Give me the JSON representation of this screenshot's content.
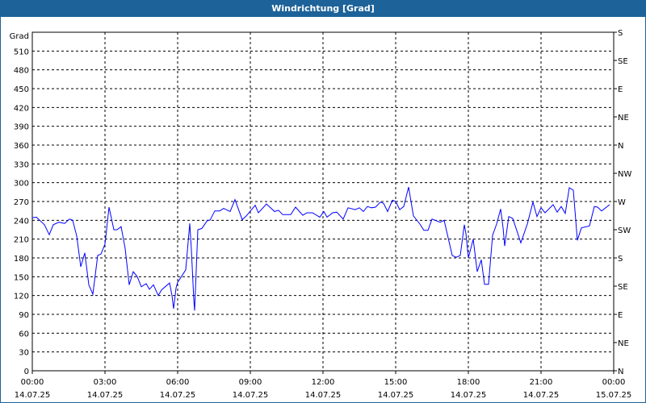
{
  "window": {
    "title": "Windrichtung [Grad]"
  },
  "colors": {
    "titlebar": "#1d6399",
    "series": "#0000ff",
    "grid": "#000000"
  },
  "chart_data": {
    "type": "line",
    "title": "Windrichtung [Grad]",
    "ylabel": "Grad",
    "ylim": [
      0,
      540
    ],
    "y_ticks": [
      0,
      30,
      60,
      90,
      120,
      150,
      180,
      210,
      240,
      270,
      300,
      330,
      360,
      390,
      420,
      450,
      480,
      510
    ],
    "y2_ticks": [
      {
        "value": 540,
        "label": "S"
      },
      {
        "value": 495,
        "label": "SE"
      },
      {
        "value": 450,
        "label": "E"
      },
      {
        "value": 405,
        "label": "NE"
      },
      {
        "value": 360,
        "label": "N"
      },
      {
        "value": 315,
        "label": "NW"
      },
      {
        "value": 270,
        "label": "W"
      },
      {
        "value": 225,
        "label": "SW"
      },
      {
        "value": 180,
        "label": "S"
      },
      {
        "value": 135,
        "label": "SE"
      },
      {
        "value": 90,
        "label": "E"
      },
      {
        "value": 45,
        "label": "NE"
      },
      {
        "value": 0,
        "label": "N"
      }
    ],
    "xlim": [
      "14.07.25 00:00",
      "15.07.25 00:00"
    ],
    "x_ticks": [
      {
        "time": "00:00",
        "date": "14.07.25"
      },
      {
        "time": "03:00",
        "date": "14.07.25"
      },
      {
        "time": "06:00",
        "date": "14.07.25"
      },
      {
        "time": "09:00",
        "date": "14.07.25"
      },
      {
        "time": "12:00",
        "date": "14.07.25"
      },
      {
        "time": "15:00",
        "date": "14.07.25"
      },
      {
        "time": "18:00",
        "date": "14.07.25"
      },
      {
        "time": "21:00",
        "date": "14.07.25"
      },
      {
        "time": "00:00",
        "date": "15.07.25"
      }
    ],
    "grid": true,
    "series": [
      {
        "x": [
          "00:00",
          "00:10",
          "00:30",
          "00:42",
          "00:52",
          "01:06",
          "01:20",
          "01:32",
          "01:40",
          "01:50",
          "02:00",
          "02:10",
          "02:20",
          "02:30",
          "02:42",
          "02:50",
          "03:00",
          "03:10",
          "03:22",
          "03:30",
          "03:40",
          "03:50",
          "04:00",
          "04:10",
          "04:20",
          "04:30",
          "04:42",
          "04:50",
          "05:00",
          "05:12",
          "05:20",
          "05:40",
          "05:46",
          "05:50",
          "05:56",
          "06:00",
          "06:20",
          "06:30",
          "06:34",
          "06:40",
          "06:42",
          "06:50",
          "07:00",
          "07:14",
          "07:20",
          "07:32",
          "07:44",
          "07:54",
          "08:10",
          "08:22",
          "08:40",
          "08:50",
          "09:12",
          "09:20",
          "09:40",
          "10:00",
          "10:10",
          "10:20",
          "10:40",
          "10:52",
          "11:10",
          "11:20",
          "11:34",
          "11:52",
          "12:02",
          "12:10",
          "12:24",
          "12:34",
          "12:50",
          "13:02",
          "13:20",
          "13:30",
          "13:40",
          "13:50",
          "14:00",
          "14:10",
          "14:22",
          "14:30",
          "14:40",
          "14:52",
          "15:00",
          "15:10",
          "15:20",
          "15:32",
          "15:44",
          "16:00",
          "16:10",
          "16:20",
          "16:30",
          "16:50",
          "17:00",
          "17:10",
          "17:20",
          "17:30",
          "17:40",
          "17:50",
          "17:54",
          "18:00",
          "18:12",
          "18:22",
          "18:32",
          "18:40",
          "18:50",
          "19:00",
          "19:10",
          "19:20",
          "19:26",
          "19:30",
          "19:40",
          "19:50",
          "20:10",
          "20:26",
          "20:40",
          "20:50",
          "21:00",
          "21:10",
          "21:30",
          "21:40",
          "21:50",
          "22:00",
          "22:10",
          "22:20",
          "22:30",
          "22:40",
          "23:00",
          "23:12",
          "23:20",
          "23:30",
          "23:50"
        ],
        "values": [
          244,
          245,
          233,
          217,
          233,
          237,
          235,
          242,
          240,
          215,
          166,
          188,
          137,
          122,
          184,
          186,
          202,
          261,
          225,
          225,
          230,
          195,
          137,
          158,
          150,
          134,
          139,
          130,
          137,
          120,
          129,
          140,
          120,
          99,
          132,
          141,
          161,
          235,
          193,
          113,
          96,
          225,
          227,
          240,
          240,
          255,
          255,
          259,
          254,
          273,
          241,
          247,
          264,
          252,
          266,
          254,
          256,
          249,
          249,
          261,
          248,
          252,
          252,
          245,
          254,
          245,
          252,
          253,
          242,
          260,
          257,
          260,
          254,
          262,
          260,
          261,
          269,
          267,
          254,
          272,
          270,
          257,
          262,
          293,
          247,
          234,
          224,
          224,
          242,
          237,
          240,
          212,
          184,
          181,
          184,
          233,
          219,
          180,
          210,
          158,
          177,
          138,
          138,
          216,
          234,
          258,
          228,
          199,
          246,
          243,
          204,
          234,
          269,
          246,
          260,
          252,
          265,
          253,
          262,
          251,
          292,
          288,
          208,
          228,
          231,
          262,
          261,
          255,
          265
        ]
      }
    ]
  }
}
